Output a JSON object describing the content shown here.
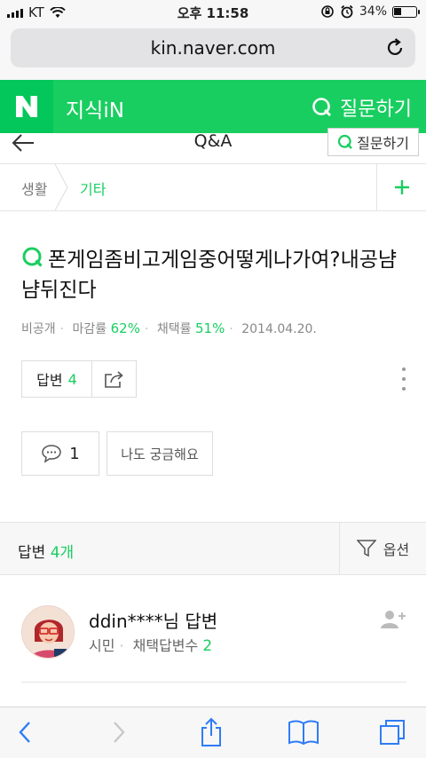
{
  "status_bar": {
    "carrier": "KT",
    "time": "오후 11:58",
    "battery": "34%"
  },
  "browser": {
    "url": "kin.naver.com"
  },
  "header": {
    "logo": "N",
    "service_name": "지식iN",
    "ask_label": "질문하기"
  },
  "subnav": {
    "title": "Q&A",
    "ask_label": "질문하기"
  },
  "breadcrumb": {
    "items": [
      "생활",
      "기타"
    ]
  },
  "question": {
    "title": "폰게임좀비고게임중어떻게나가여?내공냠냠뒤진다",
    "author": "비공개",
    "close_rate_label": "마감률",
    "close_rate": "62%",
    "adopt_rate_label": "채택률",
    "adopt_rate": "51%",
    "date": "2014.04.20.",
    "answer_label": "답변",
    "answer_count": "4",
    "comment_count": "1",
    "curious_label": "나도 궁금해요"
  },
  "answers_header": {
    "label": "답변",
    "count": "4개",
    "options_label": "옵션"
  },
  "answer": {
    "author": "ddin****님 답변",
    "rank": "시민",
    "adopted_label": "채택답변수",
    "adopted_count": "2"
  },
  "colors": {
    "brand_green": "#19ce60",
    "logo_green": "#03c75a"
  }
}
